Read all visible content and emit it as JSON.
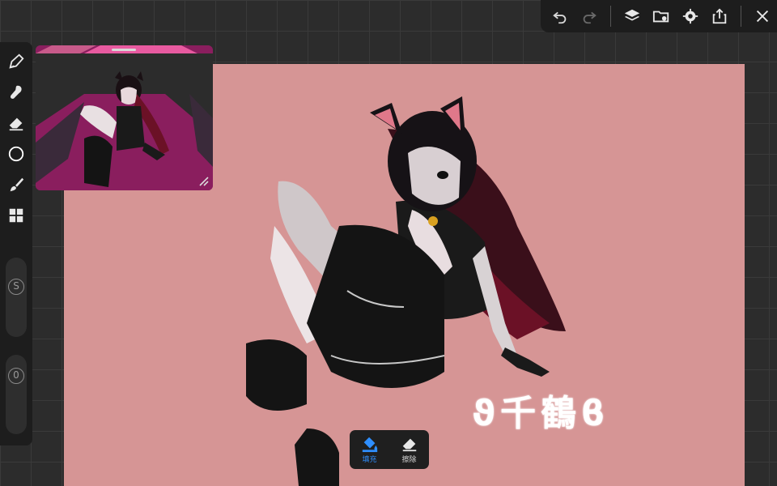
{
  "toolbar": {
    "icons": [
      "undo-icon",
      "redo-icon",
      "layers-icon",
      "gallery-icon",
      "settings-icon",
      "export-icon",
      "close-icon"
    ]
  },
  "tools": {
    "icons": [
      "pen-icon",
      "smudge-icon",
      "eraser-icon",
      "shape-icon",
      "brush-icon",
      "modules-icon"
    ]
  },
  "sliders": {
    "size_label": "S",
    "opacity_label": "0"
  },
  "canvas": {
    "background": "#d69595",
    "watermark": "ϑ千鶴ϐ"
  },
  "popup": {
    "fill_label": "填充",
    "erase_label": "擦除",
    "accent": "#2f8fff"
  }
}
